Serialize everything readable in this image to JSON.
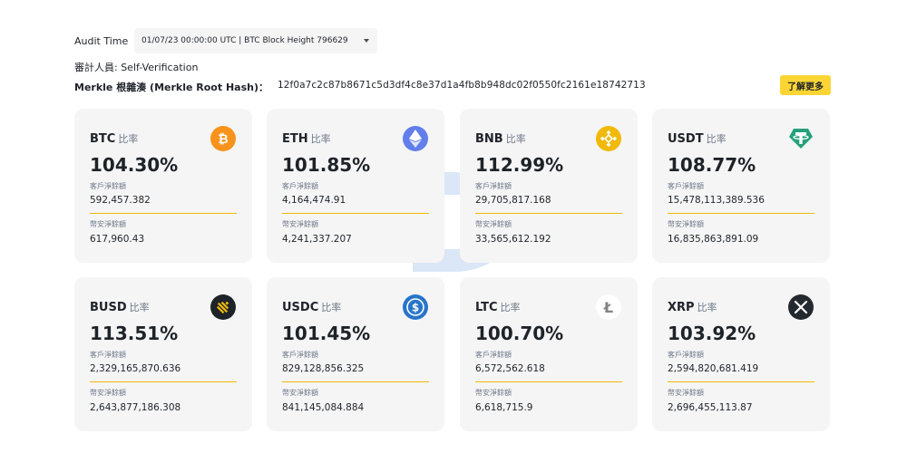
{
  "header": {
    "audit_label": "Audit Time",
    "audit_selected": "01/07/23 00:00:00 UTC | BTC Block Height 796629",
    "auditor_text": "審計人員: Self-Verification",
    "merkle_label": "Merkle 根雜湊 (Merkle Root Hash)：",
    "merkle_hash": "12f0a7c2c87b8671c5d3df4c8e37d1a4fb8b948dc02f0550fc2161e18742713",
    "learn_more": "了解更多"
  },
  "ratio_word": "比率",
  "customer_label": "客戶淨餘額",
  "exchange_label": "幣安淨餘額",
  "cards": [
    {
      "coin": "BTC",
      "ratio": "104.30%",
      "customer": "592,457.382",
      "exchange": "617,960.43",
      "icon": "bitcoin-icon",
      "color": "#f7931a"
    },
    {
      "coin": "ETH",
      "ratio": "101.85%",
      "customer": "4,164,474.91",
      "exchange": "4,241,337.207",
      "icon": "ethereum-icon",
      "color": "#627eea"
    },
    {
      "coin": "BNB",
      "ratio": "112.99%",
      "customer": "29,705,817.168",
      "exchange": "33,565,612.192",
      "icon": "bnb-icon",
      "color": "#f0b90b"
    },
    {
      "coin": "USDT",
      "ratio": "108.77%",
      "customer": "15,478,113,389.536",
      "exchange": "16,835,863,891.09",
      "icon": "tether-icon",
      "color": "#26a17b"
    },
    {
      "coin": "BUSD",
      "ratio": "113.51%",
      "customer": "2,329,165,870.636",
      "exchange": "2,643,877,186.308",
      "icon": "busd-icon",
      "color": "#1e2329"
    },
    {
      "coin": "USDC",
      "ratio": "101.45%",
      "customer": "829,128,856.325",
      "exchange": "841,145,084.884",
      "icon": "usdc-icon",
      "color": "#2775ca"
    },
    {
      "coin": "LTC",
      "ratio": "100.70%",
      "customer": "6,572,562.618",
      "exchange": "6,618,715.9",
      "icon": "litecoin-icon",
      "color": "#ffffff"
    },
    {
      "coin": "XRP",
      "ratio": "103.92%",
      "customer": "2,594,820,681.419",
      "exchange": "2,696,455,113.87",
      "icon": "xrp-icon",
      "color": "#23292f"
    }
  ]
}
